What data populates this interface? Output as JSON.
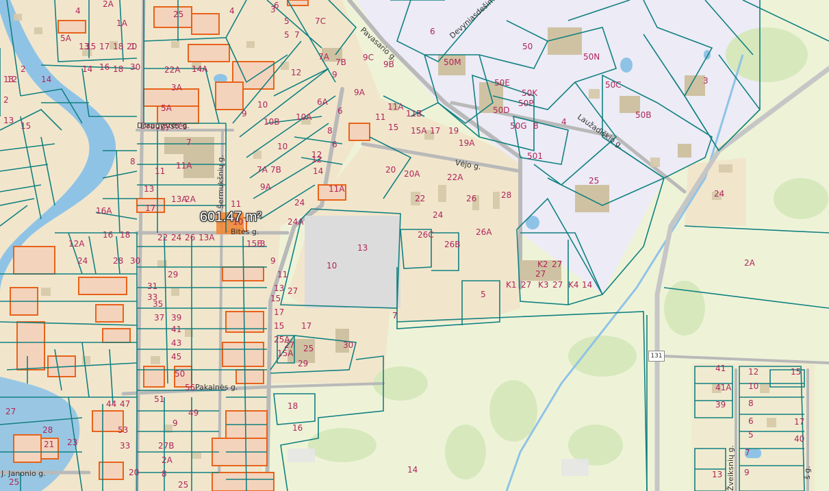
{
  "measure": {
    "area_text": "601.47 m²"
  },
  "road_shield": "131",
  "colors": {
    "river": "#8fc3e6",
    "residential": "#f1e6cc",
    "industrial": "#ecebf6",
    "green": "#eef3d8",
    "parcel_line": "#118080",
    "selected_parcel": "#e8621a",
    "label": "#b0245a"
  },
  "streets": [
    {
      "id": "pavasario",
      "text": "Pavasario g."
    },
    {
      "id": "devyniasdesim",
      "text": "Devyniasdešimt..g."
    },
    {
      "id": "lauzadiskio",
      "text": "Laužadiškio g."
    },
    {
      "id": "vejo",
      "text": "Vėjo g."
    },
    {
      "id": "draugystes",
      "text": "Draugystės g."
    },
    {
      "id": "sermuksniu",
      "text": "Šermukšnių g."
    },
    {
      "id": "bites",
      "text": "Bitės g."
    },
    {
      "id": "pakalnes",
      "text": "Pakalnės g."
    },
    {
      "id": "janonio",
      "text": "J. Janonio g."
    },
    {
      "id": "zveiksniu",
      "text": "Žveiksnių g."
    },
    {
      "id": "right_edge",
      "text": "š g."
    }
  ],
  "parcel_labels": [
    "4",
    "2A",
    "6",
    "5",
    "25",
    "3",
    "4",
    "7C",
    "6",
    "5",
    "7",
    "13",
    "1",
    "15",
    "17",
    "18",
    "20",
    "1A",
    "5A",
    "7A",
    "7B",
    "9C",
    "9B",
    "50M",
    "50",
    "50N",
    "50C",
    "3",
    "14",
    "16",
    "18",
    "30",
    "22A",
    "14A",
    "12",
    "13",
    "14",
    "9",
    "9A",
    "50E",
    "50K",
    "50P",
    "50D",
    "50G",
    "8",
    "4",
    "50B",
    "2",
    "12",
    "3A",
    "5A",
    "10",
    "9",
    "6A",
    "6",
    "11A",
    "11B",
    "11",
    "15",
    "15A",
    "17",
    "19",
    "19A",
    "501",
    "2",
    "13",
    "15",
    "Draugystės",
    "8",
    "10B",
    "10A",
    "8",
    "12",
    "7",
    "11",
    "11A",
    "6",
    "10",
    "7A",
    "7B",
    "9A",
    "12",
    "14",
    "11A",
    "20",
    "20A",
    "22A",
    "22",
    "26",
    "28",
    "24",
    "25",
    "24",
    "16A",
    "13",
    "17",
    "13A",
    "2A",
    "11",
    "10",
    "24A",
    "24",
    "26C",
    "26B",
    "26A",
    "2A",
    "27",
    "K2",
    "27",
    "27",
    "K1",
    "27",
    "K3",
    "27",
    "K4",
    "14",
    "16",
    "18",
    "22",
    "24",
    "26",
    "13A",
    "13",
    "10",
    "12A",
    "24",
    "28",
    "30",
    "15B",
    "3",
    "5",
    "7",
    "9",
    "11",
    "13",
    "15",
    "17",
    "15",
    "25A",
    "15A",
    "17",
    "25",
    "30",
    "27",
    "29",
    "9",
    "18",
    "16",
    "14",
    "12",
    "10",
    "8",
    "6",
    "5",
    "7",
    "9",
    "13",
    "15",
    "17",
    "40",
    "41",
    "41A",
    "39",
    "44",
    "47",
    "49",
    "51",
    "53",
    "33",
    "27B",
    "2A",
    "8",
    "25",
    "20",
    "28",
    "21",
    "23",
    "25",
    "27",
    "29",
    "31",
    "33",
    "35",
    "37",
    "39",
    "41",
    "43",
    "45",
    "50",
    "56"
  ],
  "map_aria": "cadastral map"
}
